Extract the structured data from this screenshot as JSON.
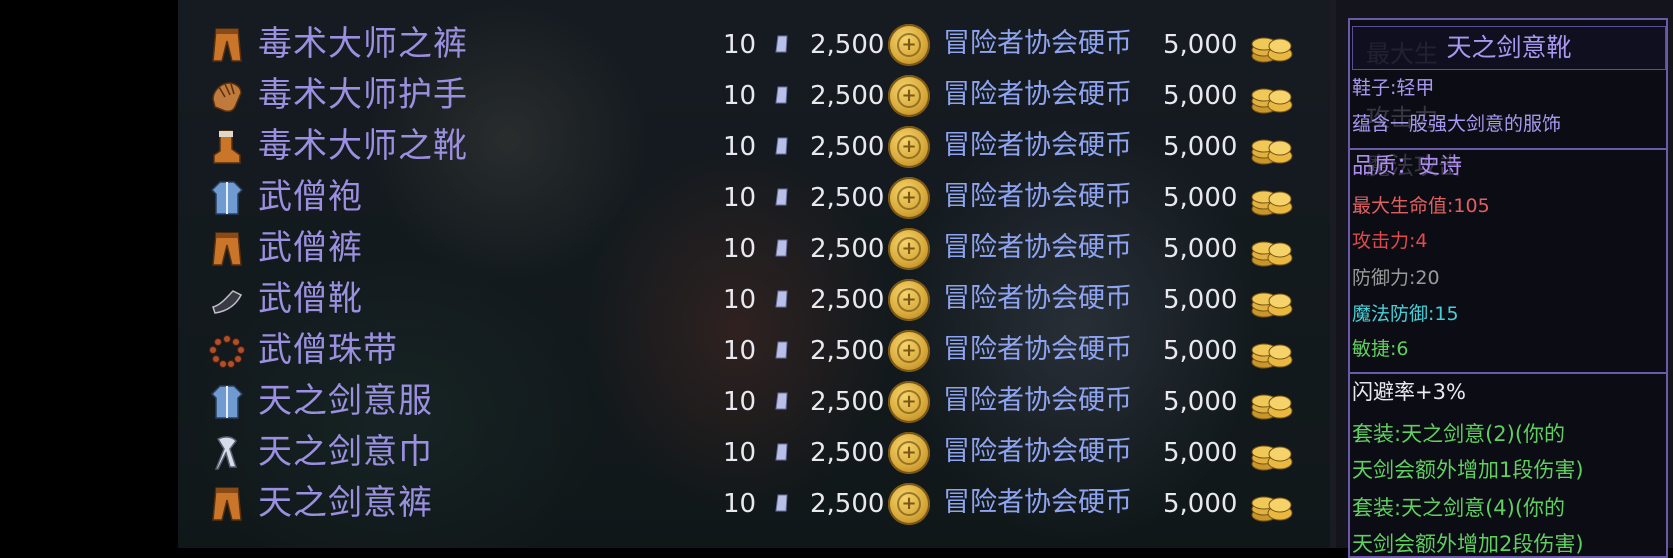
{
  "shop": {
    "rows": [
      {
        "name": "毒术大师之裤",
        "qty": "10",
        "price": "2,500",
        "currency": "冒险者协会硬币",
        "amount": "5,000",
        "icon": "pants-icon"
      },
      {
        "name": "毒术大师护手",
        "qty": "10",
        "price": "2,500",
        "currency": "冒险者协会硬币",
        "amount": "5,000",
        "icon": "glove-icon"
      },
      {
        "name": "毒术大师之靴",
        "qty": "10",
        "price": "2,500",
        "currency": "冒险者协会硬币",
        "amount": "5,000",
        "icon": "boot-icon"
      },
      {
        "name": "武僧袍",
        "qty": "10",
        "price": "2,500",
        "currency": "冒险者协会硬币",
        "amount": "5,000",
        "icon": "robe-icon"
      },
      {
        "name": "武僧裤",
        "qty": "10",
        "price": "2,500",
        "currency": "冒险者协会硬币",
        "amount": "5,000",
        "icon": "pants-icon"
      },
      {
        "name": "武僧靴",
        "qty": "10",
        "price": "2,500",
        "currency": "冒险者协会硬币",
        "amount": "5,000",
        "icon": "shoe-icon"
      },
      {
        "name": "武僧珠带",
        "qty": "10",
        "price": "2,500",
        "currency": "冒险者协会硬币",
        "amount": "5,000",
        "icon": "bead-necklace-icon"
      },
      {
        "name": "天之剑意服",
        "qty": "10",
        "price": "2,500",
        "currency": "冒险者协会硬币",
        "amount": "5,000",
        "icon": "robe-icon"
      },
      {
        "name": "天之剑意巾",
        "qty": "10",
        "price": "2,500",
        "currency": "冒险者协会硬币",
        "amount": "5,000",
        "icon": "scarf-icon"
      },
      {
        "name": "天之剑意裤",
        "qty": "10",
        "price": "2,500",
        "currency": "冒险者协会硬币",
        "amount": "5,000",
        "icon": "pants-icon"
      }
    ]
  },
  "tooltip": {
    "ghost_lines": [
      "最大生",
      "攻击力",
      "魔法攻击"
    ],
    "title": "天之剑意靴",
    "type": "鞋子:轻甲",
    "desc": "蕴含一股强大剑意的服饰",
    "quality": "品质：史诗",
    "stats": [
      {
        "text": "最大生命值:105",
        "color": "#e06060"
      },
      {
        "text": "攻击力:4",
        "color": "#e04a4a"
      },
      {
        "text": "防御力:20",
        "color": "#9a9a9a"
      },
      {
        "text": "魔法防御:15",
        "color": "#45d0d8"
      },
      {
        "text": "敏捷:6",
        "color": "#5fd060"
      }
    ],
    "evasion": "闪避率+3%",
    "set_lines": [
      "套装:天之剑意(2)(你的",
      "天剑会额外增加1段伤害)",
      "套装:天之剑意(4)(你的",
      "天剑会额外增加2段伤害)"
    ]
  },
  "colors": {
    "item_name": "#9b8fe0",
    "currency": "#8fa4f0",
    "tooltip_border": "#6a5aa8",
    "quality": "#b08cf0",
    "set": "#5fd060"
  }
}
